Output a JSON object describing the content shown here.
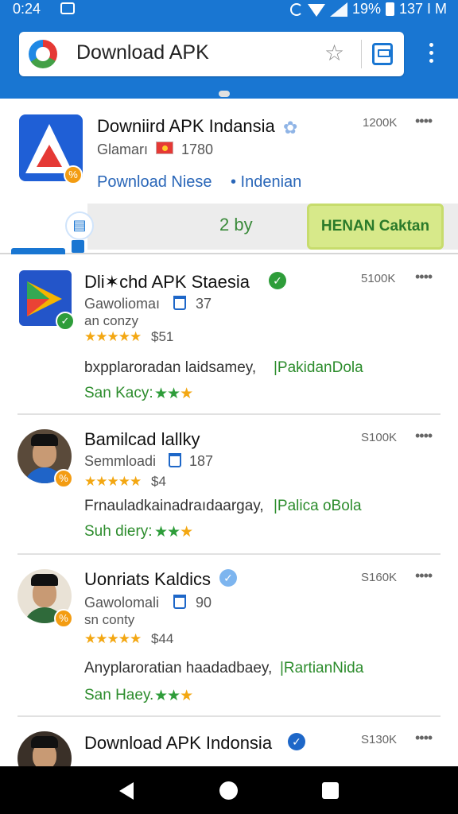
{
  "status_bar": {
    "time": "0:24",
    "battery": "19%",
    "clock_right": "137 I M",
    "icons": [
      "app-notification-icon",
      "sync-icon",
      "wifi-icon",
      "signal-icon",
      "battery-icon"
    ]
  },
  "toolbar": {
    "url_text": "Download APK",
    "star_icon": "☆",
    "colors": {
      "bar": "#1976d2",
      "accent": "#1976d2"
    }
  },
  "featured": {
    "title": "Downiird APK Indansia",
    "verified_icon": "✿",
    "price": "1200K",
    "more": "••••",
    "subtitle": "Glamarı",
    "count": "1780",
    "link_left": "Pownload Niese",
    "link_right": "• Indenian",
    "meta": "2 by",
    "action_label": "HENAN Caktan",
    "badge": "%"
  },
  "list": [
    {
      "title": "Dli✶chd APK Staesia",
      "verified": "✓",
      "price": "5100K",
      "more": "••••",
      "sub": "Gawoliomaı",
      "count": "37",
      "sub2": "an conzy",
      "stars": "★★★★★",
      "amount": "$51",
      "desc": "bxpplaroradan laidsamey,",
      "tag": "|PakidanDola",
      "foot": "San Kacy:",
      "foot_stars_green": "★★",
      "foot_stars_orange": "★",
      "badge": "✓"
    },
    {
      "title": "Bamilcad lallky",
      "price": "S100K",
      "more": "••••",
      "sub": "Semmloadi",
      "count": "187",
      "stars": "★★★★★",
      "amount": "$4",
      "desc": "Frnauladkainadraıdaargay,",
      "tag": "|Palica oBola",
      "foot": "Suh diery:",
      "foot_stars_green": "★★",
      "foot_stars_orange": "★",
      "badge": "%"
    },
    {
      "title": "Uonriats Kaldics",
      "verified": "✓",
      "price": "S160K",
      "more": "••••",
      "sub": "Gawolomali",
      "count": "90",
      "sub2": "sn conty",
      "stars": "★★★★★",
      "amount": "$44",
      "desc": "Anyplaroratian haadadbaey,",
      "tag": "|RartianNida",
      "foot": "San Haey.",
      "foot_stars_green": "★★",
      "foot_stars_orange": "★",
      "badge": "%"
    },
    {
      "title": "Download APK Indonsia",
      "verified": "✓",
      "price": "S130K",
      "more": "••••"
    }
  ]
}
